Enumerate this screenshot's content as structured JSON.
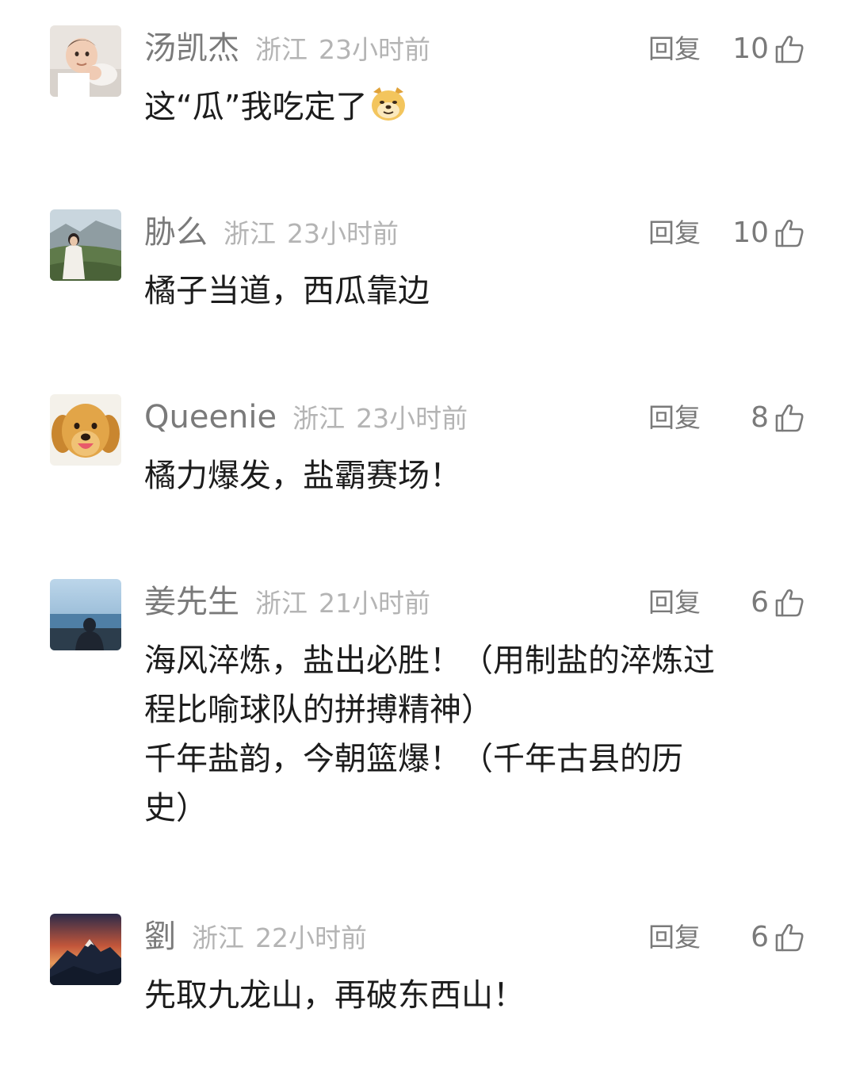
{
  "comments": [
    {
      "username": "汤凯杰",
      "location": "浙江",
      "time": "23小时前",
      "reply_label": "回复",
      "likes": "10",
      "lines": [
        "这“瓜”我吃定了"
      ],
      "emoji": "doge-emoji",
      "avatar": "baby-photo-avatar"
    },
    {
      "username": "胁么",
      "location": "浙江",
      "time": "23小时前",
      "reply_label": "回复",
      "likes": "10",
      "lines": [
        "橘子当道，西瓜靠边"
      ],
      "avatar": "girl-landscape-avatar"
    },
    {
      "username": "Queenie",
      "location": "浙江",
      "time": "23小时前",
      "reply_label": "回复",
      "likes": "8",
      "lines": [
        "橘力爆发，盐霸赛场！"
      ],
      "avatar": "golden-retriever-avatar"
    },
    {
      "username": "姜先生",
      "location": "浙江",
      "time": "21小时前",
      "reply_label": "回复",
      "likes": "6",
      "lines": [
        "海风淬炼，盐出必胜！（用制盐的淬炼过",
        "程比喻球队的拼搏精神）",
        "千年盐韵，今朝篮爆！（千年古县的历",
        "史）"
      ],
      "avatar": "seaside-man-avatar"
    },
    {
      "username": "劉",
      "location": "浙江",
      "time": "22小时前",
      "reply_label": "回复",
      "likes": "6",
      "lines": [
        "先取九龙山，再破东西山！"
      ],
      "avatar": "mountain-sunset-avatar"
    }
  ],
  "icons": {
    "like": "thumbs-up-icon"
  },
  "colors": {
    "username": "#7a7a7a",
    "meta": "#b4b4b4",
    "text": "#1c1c1c",
    "background": "#ffffff"
  }
}
